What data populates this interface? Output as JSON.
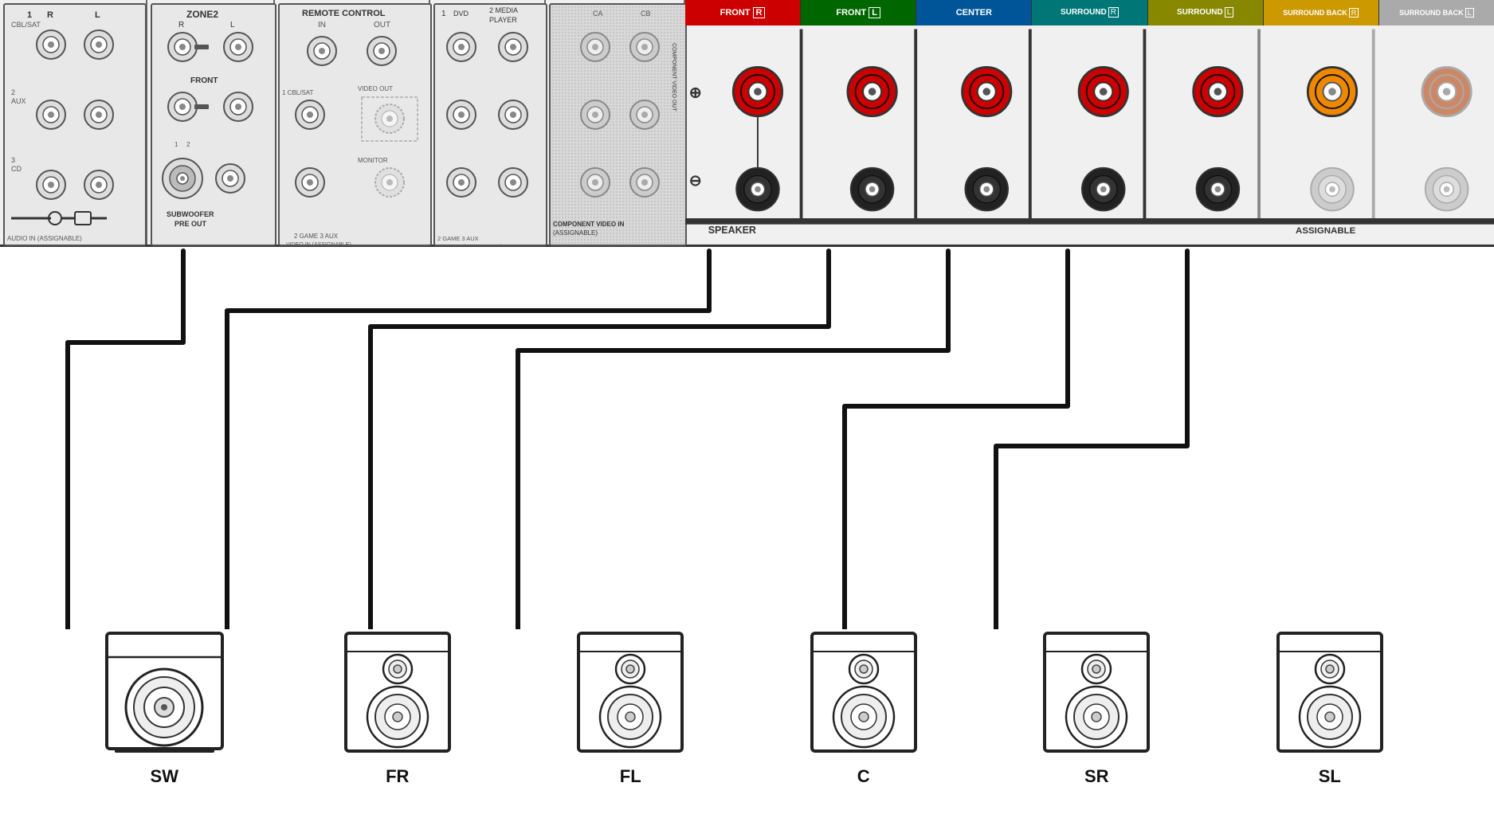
{
  "panel": {
    "sections": {
      "audio_in": {
        "label": "AUDIO IN (ASSIGNABLE)",
        "rows": [
          "1 CBL/SAT",
          "2 AUX",
          "3 CD"
        ]
      },
      "zone2": {
        "label": "ZONE2",
        "sub_labels": [
          "FRONT",
          "SUBWOOFER",
          "PRE OUT"
        ]
      },
      "remote_control": {
        "title": "REMOTE CONTROL",
        "in_label": "IN",
        "out_label": "OUT",
        "row1": "1 CBL/SAT",
        "row2": "VIDEO OUT",
        "row3": "MONITOR"
      },
      "dvd": {
        "labels": [
          "1 DVD",
          "2 MEDIA PLAYER"
        ],
        "game_label": "2 GAME",
        "aux_label": "3 AUX",
        "video_in": "VIDEO IN (ASSIGNABLE)"
      },
      "component": {
        "in_label": "COMPONENT VIDEO IN (ASSIGNABLE)",
        "out_label": "COMPONENT VIDEO OUT"
      },
      "speakers": {
        "channels": [
          {
            "name": "FRONT R",
            "color": "#cc0000",
            "text_color": "#fff"
          },
          {
            "name": "FRONT L",
            "color": "#006600",
            "text_color": "#fff"
          },
          {
            "name": "CENTER",
            "color": "#005599",
            "text_color": "#fff"
          },
          {
            "name": "SURROUND R",
            "color": "#007777",
            "text_color": "#fff"
          },
          {
            "name": "SURROUND L",
            "color": "#888800",
            "text_color": "#fff"
          },
          {
            "name": "SURROUND BACK R",
            "color": "#cc9900",
            "text_color": "#fff"
          },
          {
            "name": "SURROUND BACK L",
            "color": "#999999",
            "text_color": "#fff"
          }
        ],
        "bottom_label": "SPEAKER",
        "assignable_label": "ASSIGNABLE"
      }
    }
  },
  "speaker_units": [
    {
      "id": "SW",
      "label": "SW",
      "type": "subwoofer"
    },
    {
      "id": "FR",
      "label": "FR",
      "type": "speaker"
    },
    {
      "id": "FL",
      "label": "FL",
      "type": "speaker"
    },
    {
      "id": "C",
      "label": "C",
      "type": "speaker"
    },
    {
      "id": "SR",
      "label": "SR",
      "type": "speaker"
    },
    {
      "id": "SL",
      "label": "SL",
      "type": "speaker"
    }
  ]
}
